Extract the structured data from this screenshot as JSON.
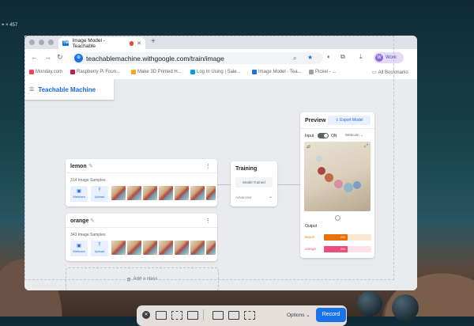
{
  "desktop": {
    "corner_label": "⌖ × 457"
  },
  "browser": {
    "tab_title": "Image Model - Teachable",
    "tab_favicon": "TM",
    "new_tab": "+",
    "url": "teachablemachine.withgoogle.com/train/image",
    "profile_label": "Work",
    "profile_initial": "W",
    "bookmarks": [
      {
        "label": "Monday.com",
        "color": "#ff3d57"
      },
      {
        "label": "Raspberry Pi Foun...",
        "color": "#c51a4a"
      },
      {
        "label": "Make 3D Printed H...",
        "color": "#f5a623"
      },
      {
        "label": "Log In Using | Sale...",
        "color": "#00a1e0"
      },
      {
        "label": "Image Model - Tea...",
        "color": "#1a73e8"
      },
      {
        "label": "Pickel - ...",
        "color": "#9aa0a6"
      }
    ],
    "all_bookmarks": "All Bookmarks"
  },
  "app": {
    "logo": "Teachable Machine",
    "classes": [
      {
        "name": "lemon",
        "samples": "314 Image Samples",
        "webcam": "Webcam",
        "upload": "Upload"
      },
      {
        "name": "orange",
        "samples": "343 Image Samples",
        "webcam": "Webcam",
        "upload": "Upload"
      }
    ],
    "add_class": "Add a class",
    "training": {
      "title": "Training",
      "button": "Model Trained",
      "advanced": "Advanced"
    },
    "preview": {
      "title": "Preview",
      "export": "Export Model",
      "input_label": "Input",
      "toggle_state": "ON",
      "source": "Webcam",
      "output_label": "Output",
      "results": [
        {
          "label": "lemon",
          "value": 0.5,
          "value_text": "0%",
          "color": "#e8710a",
          "bg": "#fde7d3"
        },
        {
          "label": "orange",
          "value": 0.5,
          "value_text": "5%",
          "color": "#e8507a",
          "bg": "#fde0e8"
        }
      ]
    }
  },
  "recorder": {
    "options": "Options",
    "record": "Record"
  },
  "icons": [
    "search-icon",
    "star-icon",
    "extensions-icon",
    "download-icon",
    "menu-icon",
    "pencil-icon",
    "webcam-icon",
    "upload-icon",
    "chevron-down-icon",
    "flip-icon",
    "close-icon"
  ]
}
